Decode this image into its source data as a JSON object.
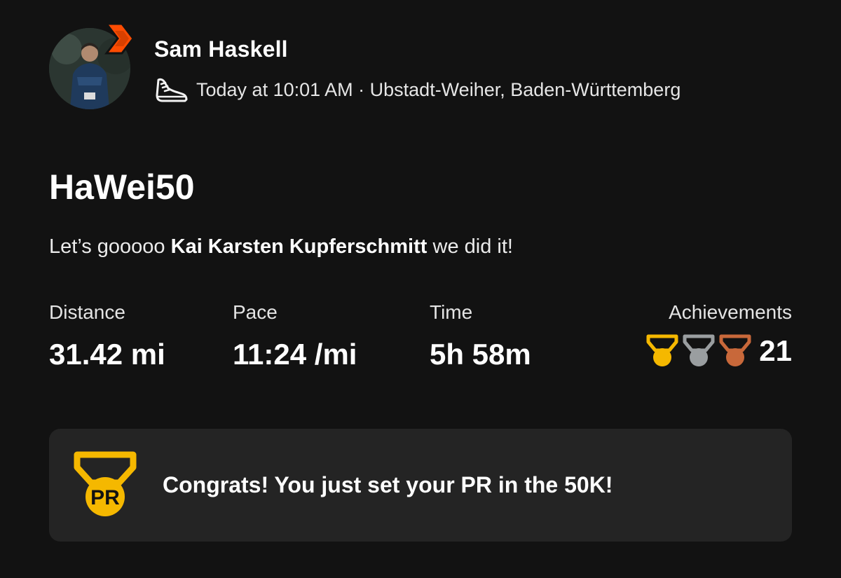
{
  "header": {
    "athlete_name": "Sam Haskell",
    "meta": "Today at 10:01 AM · Ubstadt-Weiher, Baden-Württemberg",
    "activity_icon": "running-shoe-icon",
    "badge_icon": "subscriber-chevron-icon"
  },
  "activity": {
    "title": "HaWei50",
    "description_prefix": "Let’s gooooo ",
    "description_mention": "Kai Karsten Kupferschmitt",
    "description_suffix": " we did it!"
  },
  "stats": {
    "distance_label": "Distance",
    "distance_value": "31.42 mi",
    "pace_label": "Pace",
    "pace_value": "11:24 /mi",
    "time_label": "Time",
    "time_value": "5h 58m",
    "achievements_label": "Achievements",
    "achievements_count": "21",
    "medal_icons": [
      "gold-medal-icon",
      "silver-medal-icon",
      "bronze-medal-icon"
    ]
  },
  "pr_banner": {
    "icon": "pr-medal-icon",
    "icon_text": "PR",
    "message": "Congrats! You just set your PR in the 50K!"
  },
  "colors": {
    "background": "#121212",
    "banner_background": "#242424",
    "strava_orange": "#fc4c02",
    "gold": "#f5b800",
    "silver": "#9a9ea0",
    "bronze": "#c8683a"
  }
}
